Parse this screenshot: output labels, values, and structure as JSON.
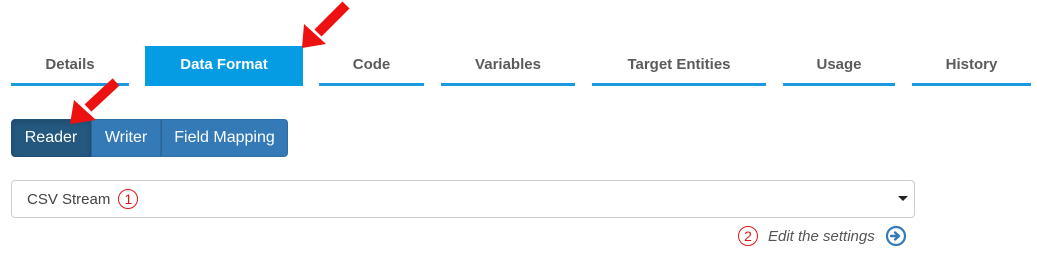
{
  "tabs": [
    {
      "label": "Details"
    },
    {
      "label": "Data Format"
    },
    {
      "label": "Code"
    },
    {
      "label": "Variables"
    },
    {
      "label": "Target Entities"
    },
    {
      "label": "Usage"
    },
    {
      "label": "History"
    }
  ],
  "active_tab": "Data Format",
  "subtabs": [
    {
      "label": "Reader"
    },
    {
      "label": "Writer"
    },
    {
      "label": "Field Mapping"
    }
  ],
  "active_subtab": "Reader",
  "format_select": {
    "value": "CSV Stream",
    "callout": "1"
  },
  "edit_settings": {
    "label": "Edit the settings",
    "callout": "2"
  },
  "colors": {
    "accent": "#069ce4",
    "button": "#337ab7",
    "button_active": "#24587f",
    "callout": "#e01818",
    "pointer_arrow": "#ee1111"
  }
}
